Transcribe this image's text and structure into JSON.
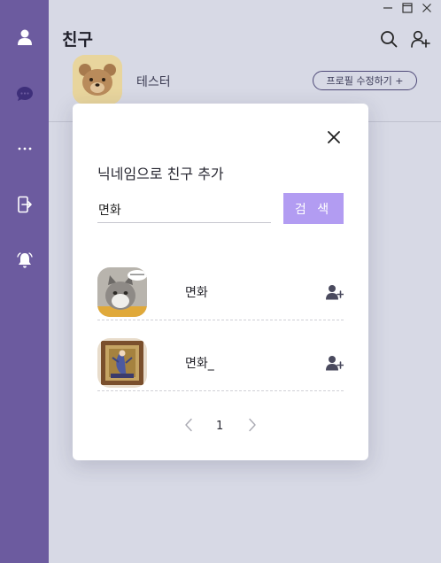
{
  "page": {
    "title": "친구"
  },
  "sidebar": {
    "items": [
      {
        "icon": "user-icon"
      },
      {
        "icon": "chat-icon"
      },
      {
        "icon": "more-icon"
      },
      {
        "icon": "logout-icon"
      },
      {
        "icon": "bell-icon"
      }
    ]
  },
  "header": {
    "search_icon": "search-icon",
    "add_friend_icon": "add-friend-icon"
  },
  "profile": {
    "name": "테스터",
    "edit_label": "프로필 수정하기 +"
  },
  "modal": {
    "title": "닉네임으로 친구 추가",
    "search_value": "면화",
    "search_placeholder": "",
    "search_button": "검 색",
    "results": [
      {
        "name": "면화"
      },
      {
        "name": "면화_"
      }
    ],
    "pagination": {
      "current": "1"
    }
  },
  "colors": {
    "sidebar": "#6c5b9f",
    "background": "#d7d9e5",
    "accent": "#b29cf2"
  }
}
